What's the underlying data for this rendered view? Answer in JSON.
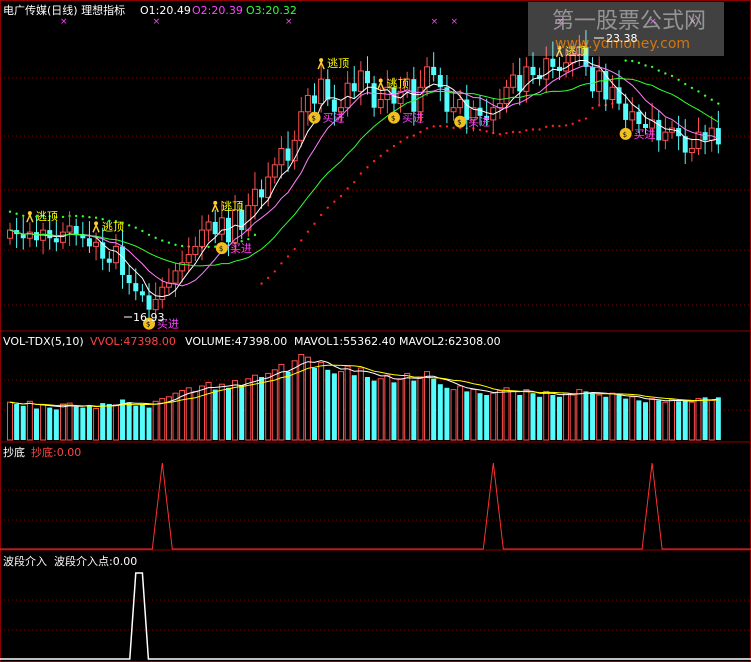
{
  "colors": {
    "bg": "#000000",
    "frame": "#8b0000",
    "up": "#ff5050",
    "down": "#54fcfc",
    "ma_white": "#ffffff",
    "ma_pink": "#ff80ff",
    "ma_green": "#33ff33",
    "dot_red": "#ff2020",
    "dot_green": "#33ff33",
    "label_buy": "#ff40ff",
    "label_sell": "#ffff00",
    "cross": "#ff44ff",
    "yellow": "#ffff00"
  },
  "main_panel": {
    "title": "电广传媒(日线) 理想指标",
    "o1_label": "O1:20.49",
    "o2_label": "O2:20.39",
    "o3_label": "O3:20.32",
    "high_label": "23.38",
    "low_label": "16.93",
    "buy_label": "买进",
    "sell_label": "逃顶"
  },
  "vol_panel": {
    "name": "VOL-TDX(5,10)",
    "vvol": "VVOL:47398.00",
    "volume": "VOLUME:47398.00",
    "mavol1": "MAVOL1:55362.40",
    "mavol2": "MAVOL2:62308.00"
  },
  "chaodi_panel": {
    "name": "抄底",
    "value": "抄底:0.00"
  },
  "boduan_panel": {
    "name": "波段介入",
    "value": "波段介入点:0.00"
  },
  "watermark": {
    "main": "第一股票公式网",
    "sub": "www.ydmoney.com"
  },
  "chart_data": {
    "type": "candlestick",
    "price_ylim": [
      16.5,
      24.0
    ],
    "close": [
      18.9,
      18.8,
      18.7,
      18.85,
      18.65,
      18.9,
      18.7,
      18.6,
      18.85,
      19.0,
      18.8,
      18.7,
      18.5,
      18.6,
      18.2,
      18.1,
      18.5,
      17.8,
      17.6,
      17.4,
      17.3,
      16.95,
      17.2,
      17.5,
      17.6,
      17.9,
      18.1,
      18.3,
      18.5,
      18.9,
      19.1,
      18.8,
      19.2,
      18.6,
      19.4,
      18.9,
      19.5,
      19.9,
      19.7,
      20.2,
      20.5,
      20.9,
      20.6,
      21.1,
      21.8,
      22.2,
      22.0,
      22.6,
      22.1,
      21.8,
      21.9,
      22.5,
      22.3,
      22.8,
      22.5,
      21.9,
      22.1,
      22.4,
      22.0,
      22.3,
      22.6,
      21.8,
      22.4,
      22.9,
      22.7,
      22.4,
      21.8,
      21.9,
      22.1,
      21.6,
      21.9,
      21.7,
      21.6,
      21.9,
      22.0,
      22.4,
      22.7,
      22.3,
      22.9,
      22.7,
      22.6,
      23.1,
      22.9,
      22.8,
      23.0,
      23.2,
      23.38,
      22.9,
      22.3,
      22.8,
      22.1,
      22.4,
      22.0,
      21.6,
      21.8,
      21.5,
      21.4,
      21.6,
      21.1,
      21.3,
      21.4,
      21.2,
      20.8,
      20.9,
      21.3,
      21.1,
      21.4,
      21.0
    ],
    "open": [
      18.7,
      18.9,
      18.8,
      18.7,
      18.85,
      18.65,
      18.9,
      18.7,
      18.6,
      18.85,
      19.0,
      18.8,
      18.7,
      18.5,
      18.6,
      18.2,
      18.1,
      18.5,
      17.8,
      17.6,
      17.4,
      17.3,
      16.95,
      17.2,
      17.5,
      17.6,
      17.9,
      18.1,
      18.3,
      18.5,
      18.9,
      19.1,
      18.8,
      19.2,
      18.6,
      19.4,
      18.9,
      19.5,
      19.9,
      19.7,
      20.2,
      20.5,
      20.9,
      20.6,
      21.1,
      21.8,
      22.2,
      22.0,
      22.6,
      22.1,
      21.8,
      21.9,
      22.5,
      22.3,
      22.8,
      22.5,
      21.9,
      22.1,
      22.4,
      22.0,
      22.3,
      22.6,
      21.8,
      22.4,
      22.9,
      22.7,
      22.4,
      21.8,
      21.9,
      22.1,
      21.6,
      21.9,
      21.7,
      21.6,
      21.9,
      22.0,
      22.4,
      22.7,
      22.3,
      22.9,
      22.7,
      22.6,
      23.1,
      22.9,
      22.8,
      23.0,
      23.2,
      23.38,
      22.9,
      22.3,
      22.8,
      22.1,
      22.4,
      22.0,
      21.6,
      21.8,
      21.5,
      21.4,
      21.6,
      21.1,
      21.3,
      21.4,
      21.2,
      20.8,
      20.9,
      21.3,
      21.1,
      21.4
    ],
    "volume_ylim": [
      0,
      100000
    ],
    "volume": [
      42000,
      40000,
      38000,
      43000,
      35000,
      39000,
      36000,
      34000,
      40000,
      41000,
      37000,
      36000,
      38000,
      35000,
      41000,
      40000,
      39000,
      45000,
      42000,
      38000,
      40000,
      36000,
      43000,
      46000,
      48000,
      52000,
      55000,
      58000,
      54000,
      60000,
      64000,
      56000,
      62000,
      58000,
      66000,
      61000,
      68000,
      72000,
      70000,
      74000,
      78000,
      84000,
      76000,
      88000,
      95000,
      92000,
      80000,
      86000,
      78000,
      74000,
      76000,
      82000,
      72000,
      80000,
      70000,
      66000,
      68000,
      72000,
      64000,
      68000,
      74000,
      66000,
      70000,
      76000,
      68000,
      62000,
      58000,
      56000,
      60000,
      54000,
      56000,
      52000,
      50000,
      52000,
      55000,
      58000,
      54000,
      50000,
      56000,
      52000,
      48000,
      54000,
      50000,
      48000,
      52000,
      50000,
      56000,
      54000,
      52000,
      50000,
      48000,
      52000,
      50000,
      46000,
      48000,
      44000,
      42000,
      46000,
      44000,
      42000,
      45000,
      43000,
      44000,
      42000,
      46000,
      47398,
      44000,
      47398
    ],
    "chaodi_signal_idx": [
      23,
      73,
      97
    ],
    "boduan_signal_idx": [
      19,
      20
    ],
    "buy_idx": [
      21,
      32,
      46,
      58,
      68,
      93
    ],
    "sell_idx": [
      3,
      13,
      31,
      47,
      56,
      83
    ]
  }
}
